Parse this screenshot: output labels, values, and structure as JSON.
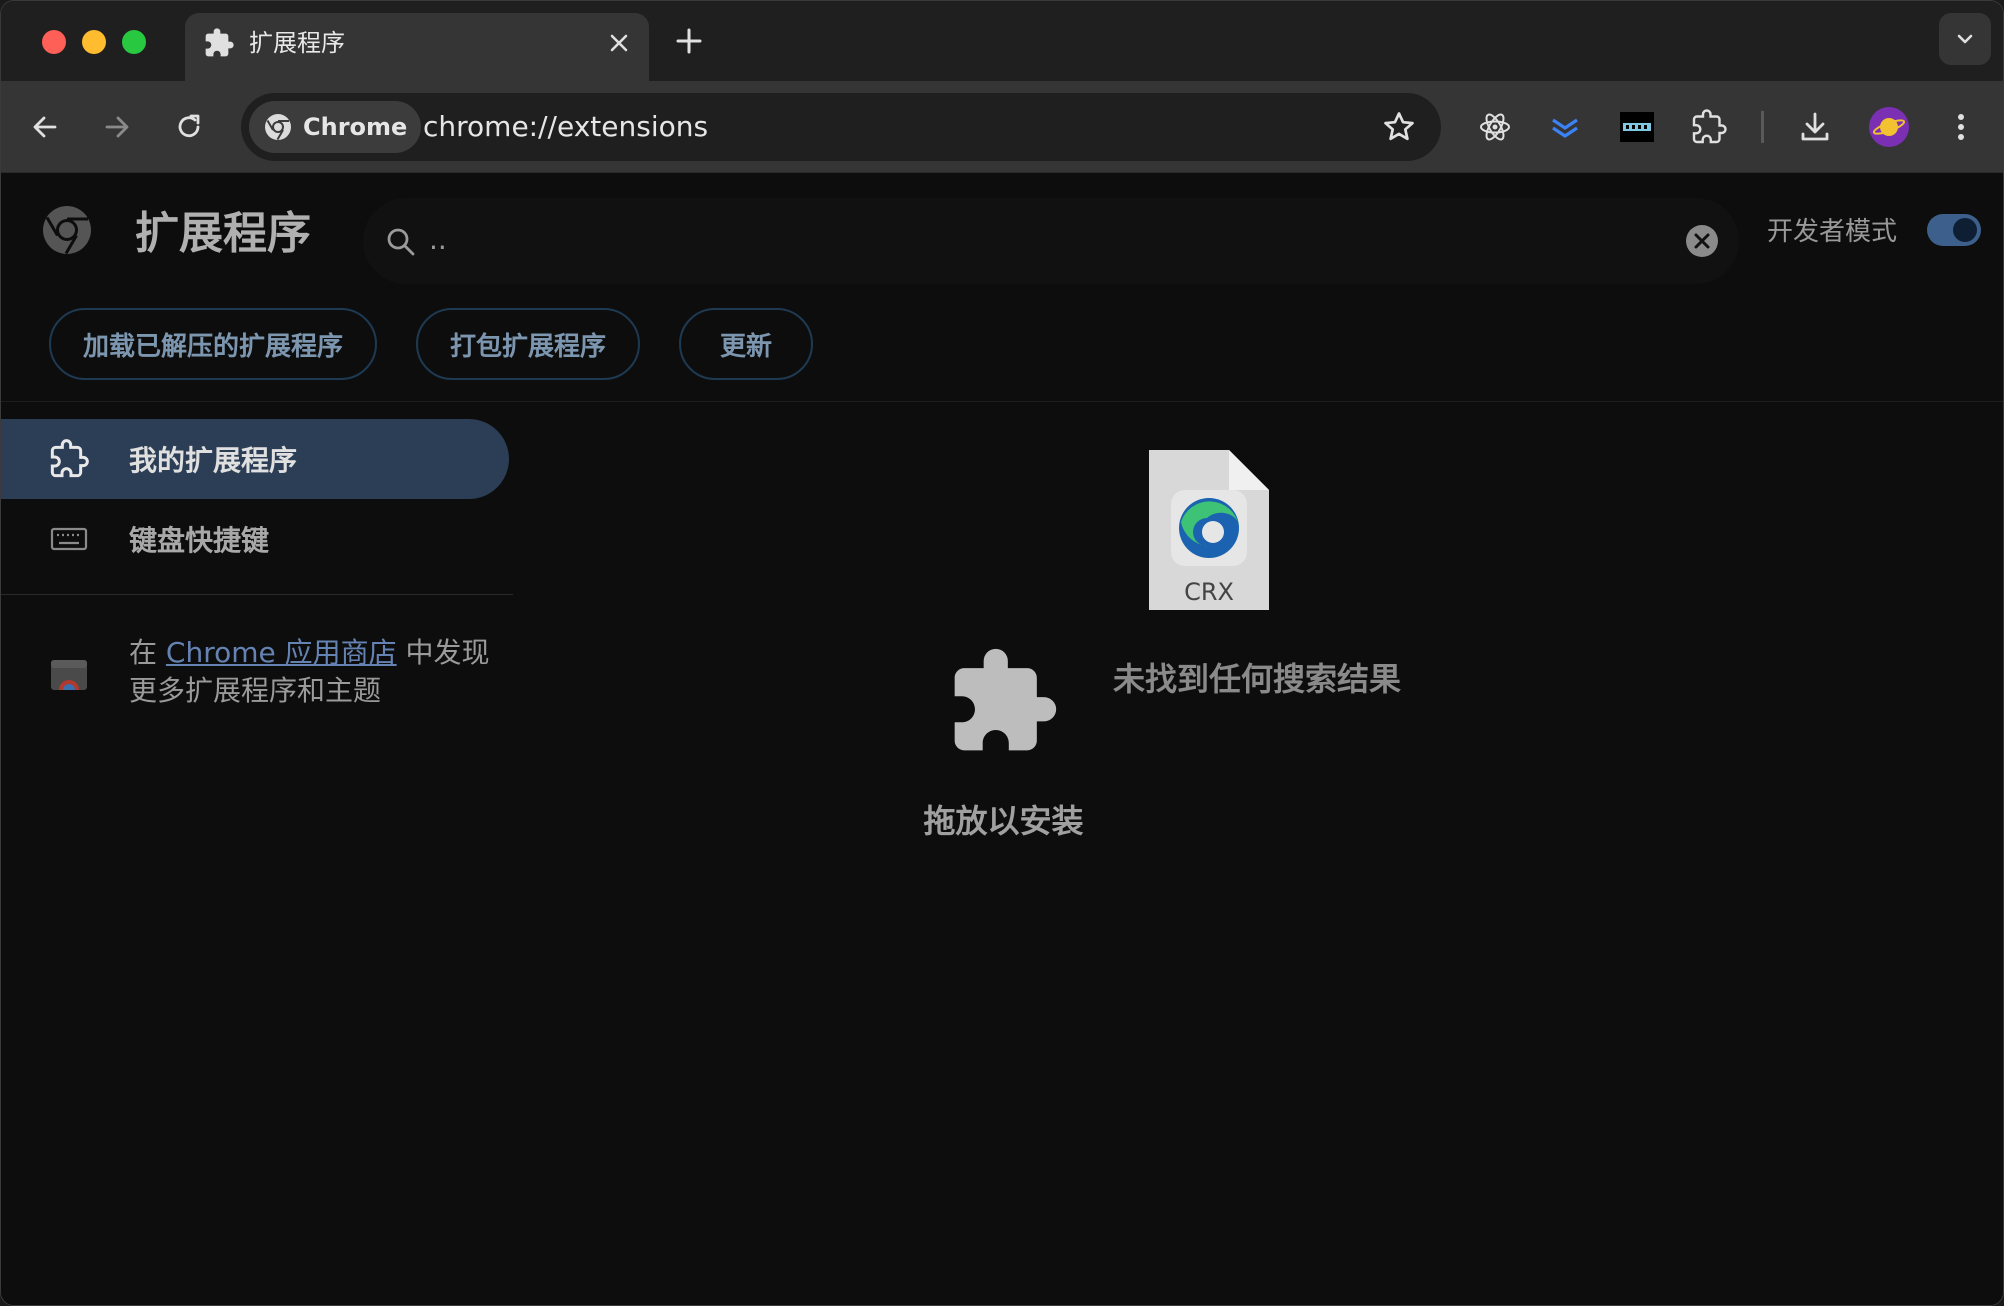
{
  "window": {
    "tab": {
      "title": "扩展程序"
    },
    "url": "chrome://extensions",
    "chip_label": "Chrome"
  },
  "toolbar_icons": [
    "back-icon",
    "forward-icon",
    "reload-icon",
    "bookmark-star-icon",
    "react-devtools-icon",
    "stacked-chevrons-icon",
    "dark-logo-icon",
    "extensions-icon",
    "download-icon",
    "profile-avatar-icon",
    "menu-dots-icon"
  ],
  "header": {
    "title": "扩展程序",
    "search_value": "..",
    "dev_mode_label": "开发者模式",
    "dev_mode_on": true
  },
  "actions": {
    "load_unpacked": "加载已解压的扩展程序",
    "pack": "打包扩展程序",
    "update": "更新"
  },
  "sidebar": {
    "items": [
      {
        "label": "我的扩展程序",
        "icon": "extension-icon",
        "active": true
      },
      {
        "label": "键盘快捷键",
        "icon": "keyboard-icon",
        "active": false
      }
    ],
    "store_prefix": "在 ",
    "store_link": "Chrome 应用商店",
    "store_suffix": " 中发现更多扩展程序和主题"
  },
  "main": {
    "crx_label": "CRX",
    "drop_label": "拖放以安装",
    "no_results": "未找到任何搜索结果"
  },
  "colors": {
    "accent": "#8ab4f8",
    "active_nav_bg": "#2c3e55",
    "background": "#0d0d0d"
  }
}
